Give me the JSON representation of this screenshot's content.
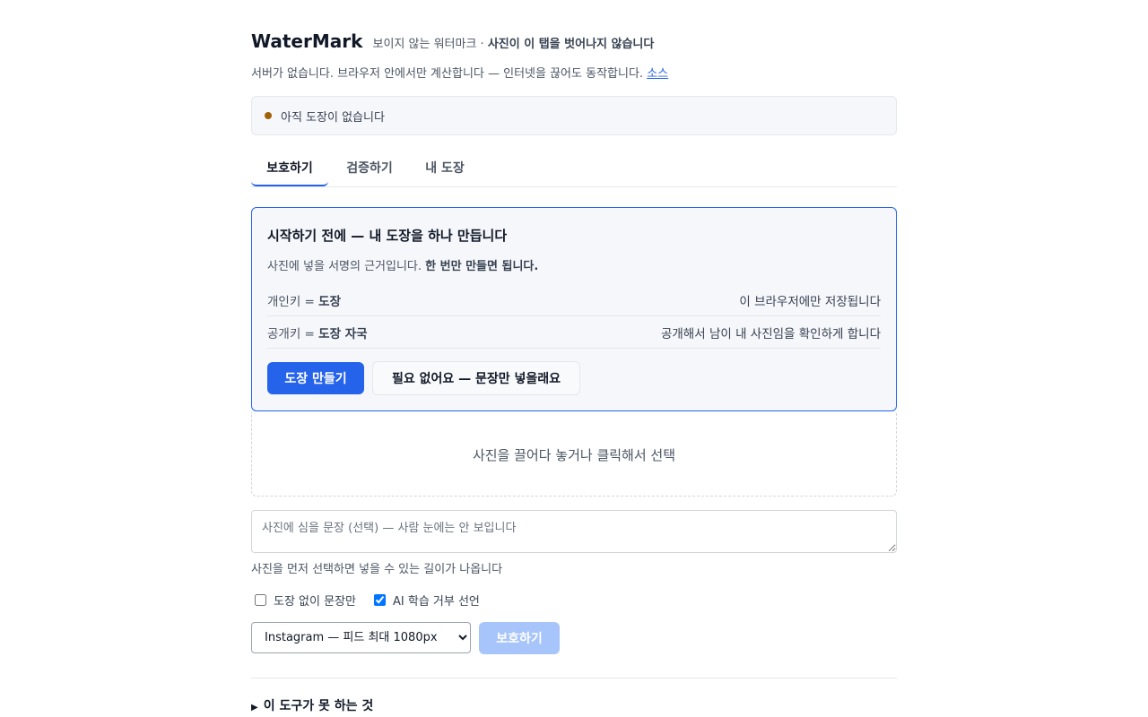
{
  "app": {
    "title": "WaterMark",
    "tagline_prefix": "보이지 않는 워터마크 · ",
    "tagline_bold": "사진이 이 탭을 벗어나지 않습니다",
    "subline": "서버가 없습니다. 브라우저 안에서만 계산합니다 — 인터넷을 끊어도 동작합니다. ",
    "source_link": "소스"
  },
  "status": {
    "text": "아직 도장이 없습니다",
    "dot_color": "#a16207"
  },
  "tabs": [
    {
      "label": "보호하기",
      "active": true
    },
    {
      "label": "검증하기",
      "active": false
    },
    {
      "label": "내 도장",
      "active": false
    }
  ],
  "setup_card": {
    "title": "시작하기 전에 — 내 도장을 하나 만듭니다",
    "desc_prefix": "사진에 넣을 서명의 근거입니다. ",
    "desc_bold": "한 번만 만들면 됩니다.",
    "rows": [
      {
        "key_prefix": "개인키 = ",
        "key_bold": "도장",
        "value": "이 브라우저에만 저장됩니다"
      },
      {
        "key_prefix": "공개키 = ",
        "key_bold": "도장 자국",
        "value": "공개해서 남이 내 사진임을 확인하게 합니다"
      }
    ],
    "create_button": "도장 만들기",
    "skip_button": "필요 없어요 — 문장만 넣을래요"
  },
  "dropzone": {
    "text": "사진을 끌어다 놓거나 클릭해서 선택"
  },
  "message": {
    "placeholder": "사진에 심을 문장 (선택) — 사람 눈에는 안 보입니다",
    "hint": "사진을 먼저 선택하면 넣을 수 있는 길이가 나옵니다"
  },
  "options": [
    {
      "label": "도장 없이 문장만",
      "checked": false
    },
    {
      "label": "AI 학습 거부 선언",
      "checked": true
    }
  ],
  "platform": {
    "selected": "Instagram — 피드 최대 1080px"
  },
  "protect_button": "보호하기",
  "details": {
    "label": "이 도구가 못 하는 것"
  },
  "colors": {
    "accent": "#2563eb",
    "disabled_button": "#a7c4fb"
  }
}
